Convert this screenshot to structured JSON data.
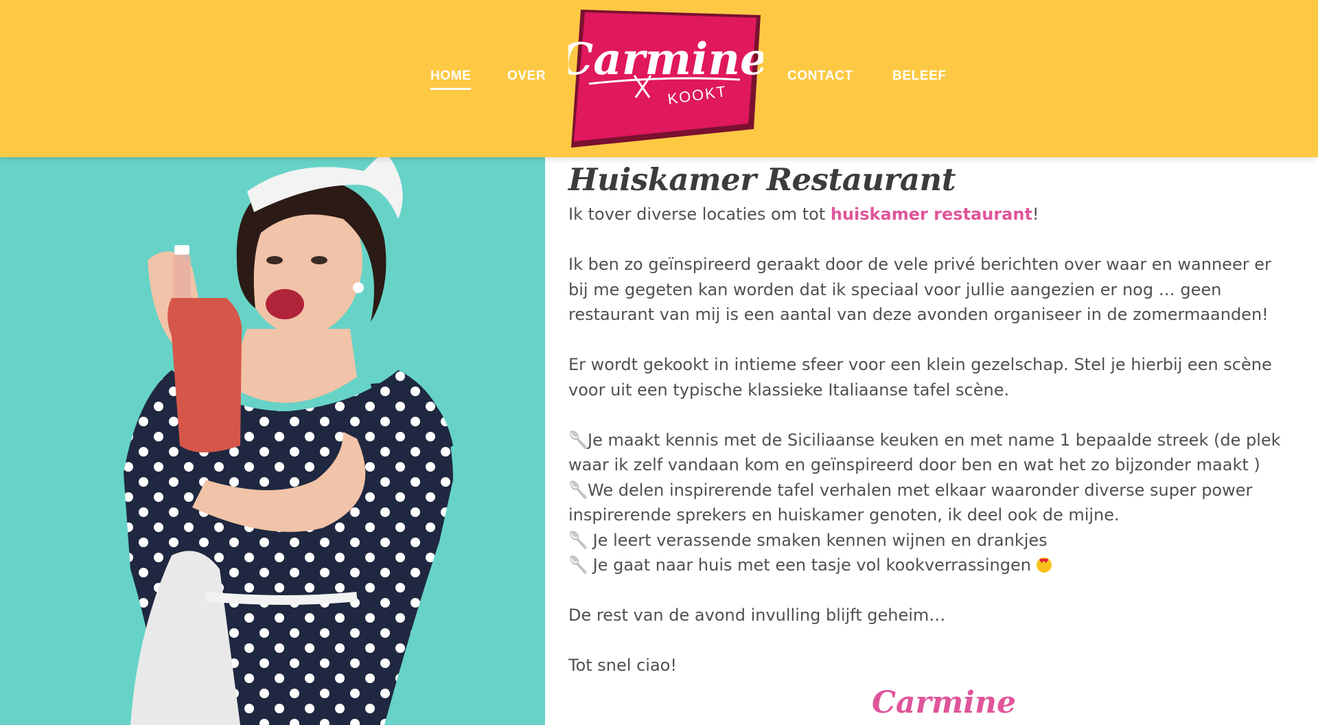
{
  "nav": {
    "items": [
      {
        "label": "HOME",
        "active": true
      },
      {
        "label": "OVER",
        "active": false
      },
      {
        "label": "CONTACT",
        "active": false
      },
      {
        "label": "BELEEF",
        "active": false
      }
    ]
  },
  "logo": {
    "name": "Carmine",
    "tagline": "KOOKT"
  },
  "colors": {
    "header": "#fdc944",
    "logo": "#e0185e",
    "accent": "#e0559a",
    "hero_bg": "#66d3c6"
  },
  "main": {
    "title": "Huiskamer Restaurant",
    "intro_before": "Ik tover diverse locaties om tot ",
    "intro_link": "huiskamer restaurant",
    "intro_after": "!",
    "para1": "Ik ben zo geïnspireerd geraakt door de vele privé berichten over waar en wanneer er bij me gegeten kan worden dat ik speciaal voor jullie aangezien er nog … geen restaurant van mij is een aantal van deze avonden organiseer in de zomermaanden!",
    "para2": "Er wordt gekookt in intieme sfeer voor een klein gezelschap. Stel je hierbij een scène voor uit een typische klassieke Italiaanse tafel scène.",
    "bullets": [
      "Je maakt kennis met de Siciliaanse keuken en met name 1 bepaalde streek (de plek waar ik zelf vandaan kom en geïnspireerd door ben en wat het zo bijzonder maakt )",
      "We delen inspirerende tafel verhalen met elkaar waaronder diverse super power inspirerende sprekers en huiskamer genoten, ik deel ook de mijne.",
      " Je leert verassende smaken kennen wijnen en drankjes",
      " Je gaat naar huis met een tasje vol kookverrassingen"
    ],
    "bullet_icon": "spoon-icon",
    "para3": "De rest van de avond invulling blijft geheim…",
    "closing": "Tot snel ciao!",
    "signature": "Carmine"
  }
}
